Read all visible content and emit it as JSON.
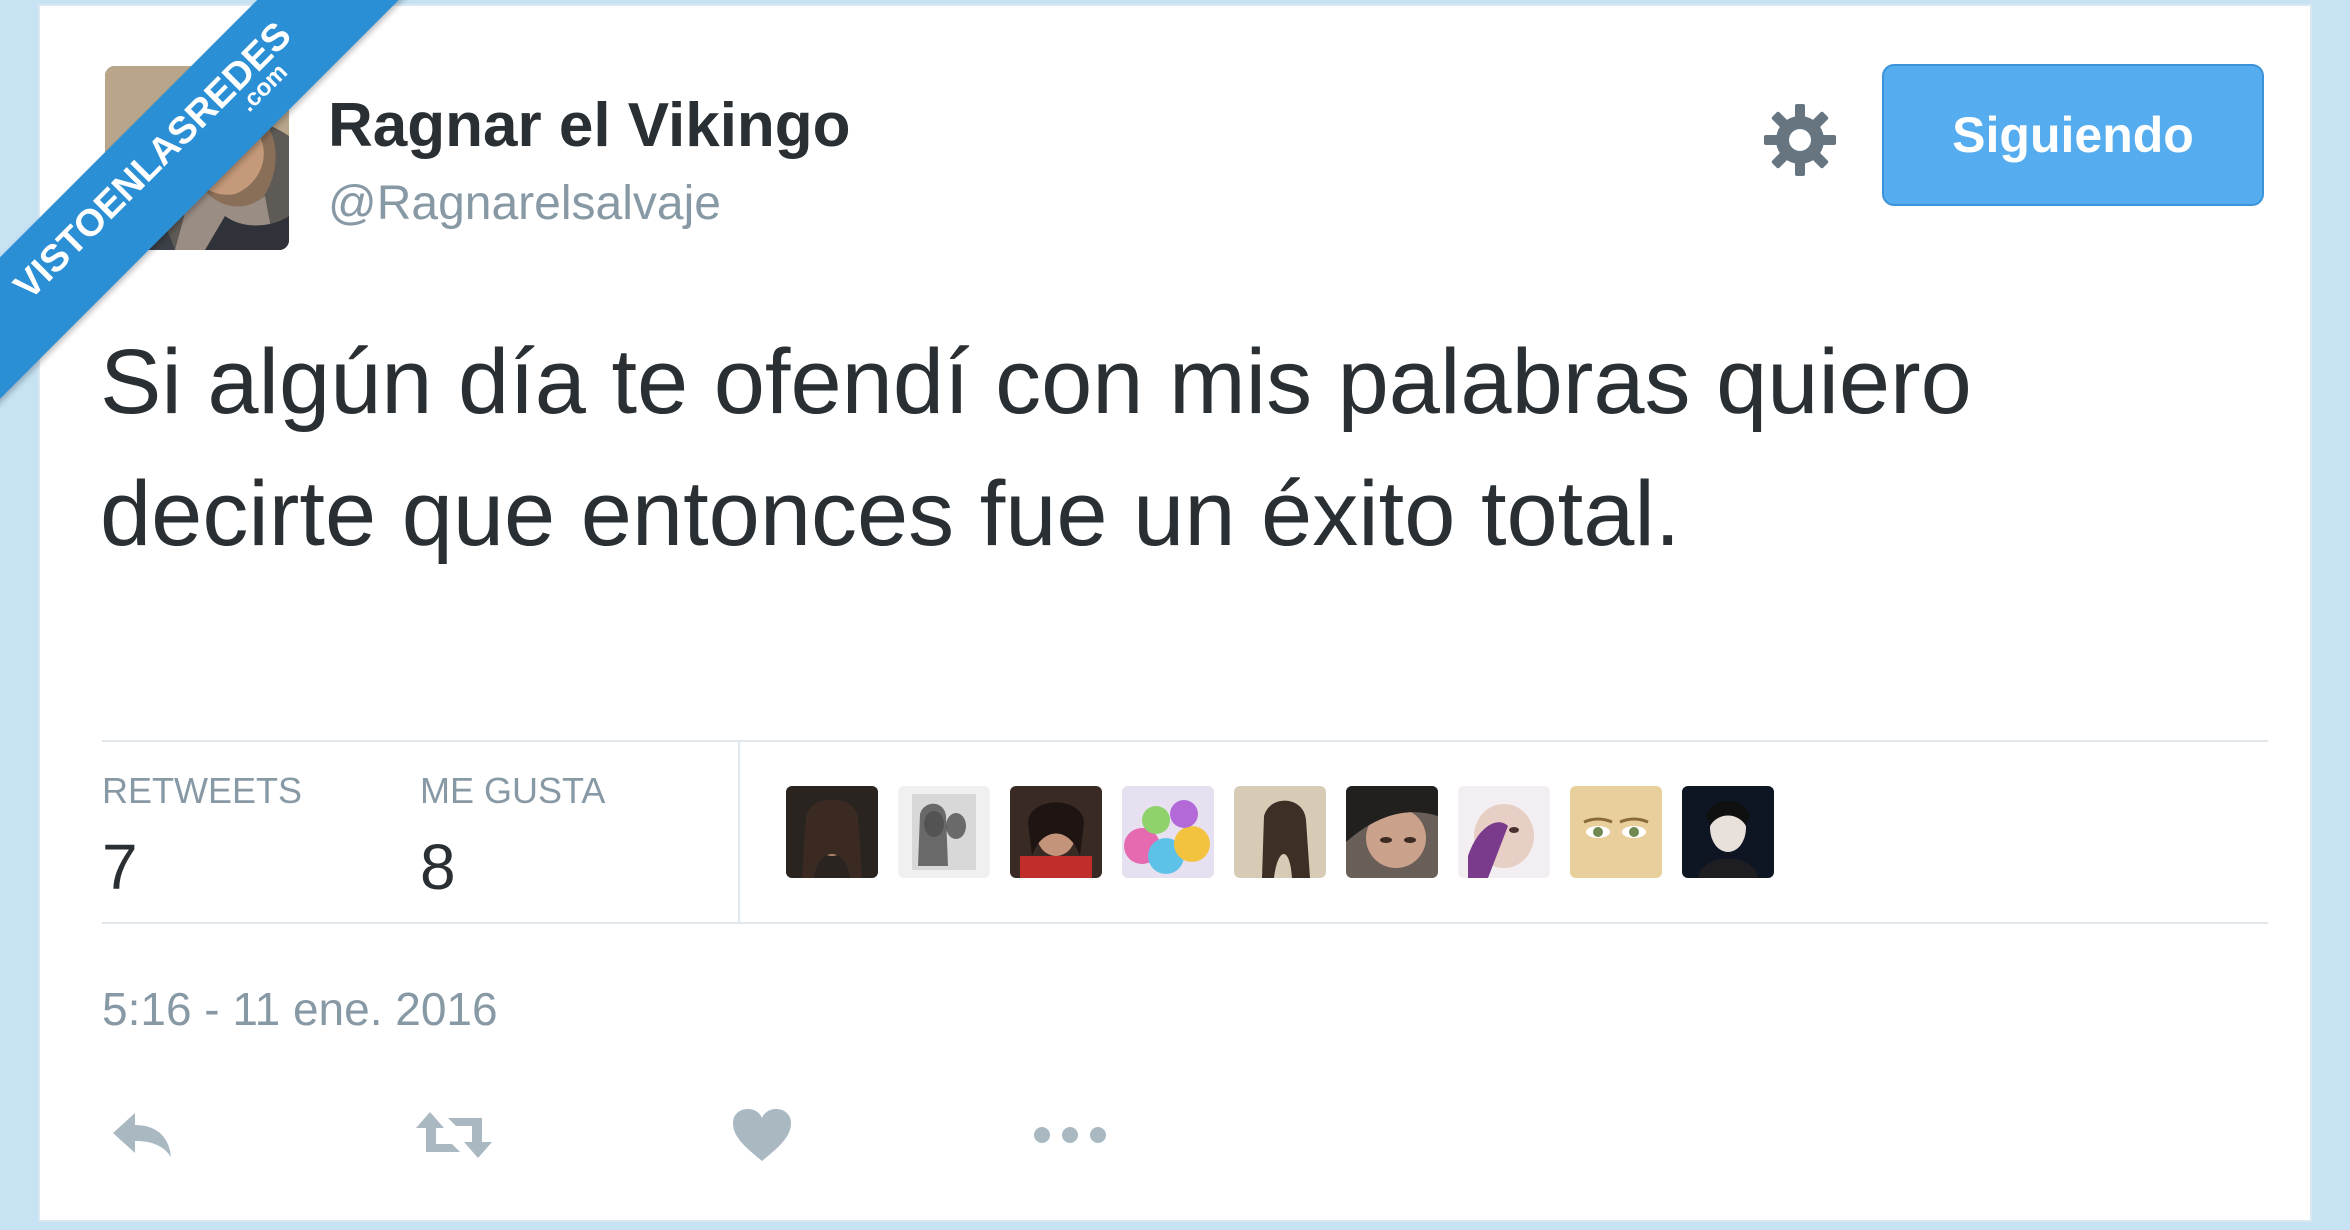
{
  "watermark": {
    "text": "VISTOENLASREDES",
    "suffix": ".com"
  },
  "header": {
    "display_name": "Ragnar el Vikingo",
    "handle": "@Ragnarelsalvaje",
    "follow_button": "Siguiendo",
    "settings_icon": "gear-icon"
  },
  "tweet": {
    "text": "Si algún día te ofendí con mis palabras quiero decirte que entonces fue un éxito total."
  },
  "stats": {
    "retweets_label": "RETWEETS",
    "retweets_count": "7",
    "likes_label": "ME GUSTA",
    "likes_count": "8"
  },
  "likers": [
    {
      "icon": "avatar-1"
    },
    {
      "icon": "avatar-2"
    },
    {
      "icon": "avatar-3"
    },
    {
      "icon": "avatar-4"
    },
    {
      "icon": "avatar-5"
    },
    {
      "icon": "avatar-6"
    },
    {
      "icon": "avatar-7"
    },
    {
      "icon": "avatar-8"
    },
    {
      "icon": "avatar-9"
    }
  ],
  "timestamp": "5:16 - 11 ene. 2016",
  "actions": [
    "reply-icon",
    "retweet-icon",
    "heart-icon",
    "more-icon"
  ],
  "colors": {
    "accent": "#55acee",
    "text": "#292f33",
    "muted": "#8899a6",
    "watermark": "#2b8fd6"
  }
}
